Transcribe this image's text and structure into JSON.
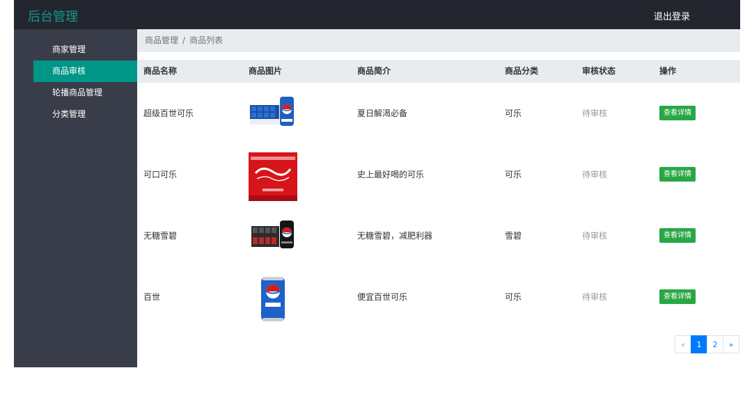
{
  "brand": "后台管理",
  "logout_label": "退出登录",
  "sidebar": {
    "items": [
      {
        "label": "商家管理",
        "active": false
      },
      {
        "label": "商品审核",
        "active": true
      },
      {
        "label": "轮播商品管理",
        "active": false
      },
      {
        "label": "分类管理",
        "active": false
      }
    ]
  },
  "breadcrumb": {
    "parent": "商品管理",
    "separator": "/",
    "current": "商品列表"
  },
  "table": {
    "headers": [
      "商品名称",
      "商品图片",
      "商品简介",
      "商品分类",
      "审核状态",
      "操作"
    ],
    "rows": [
      {
        "name": "超级百世可乐",
        "image_icon": "pepsi-case-icon",
        "intro": "夏日解渴必备",
        "category": "可乐",
        "status": "待审核",
        "action": "查看详情"
      },
      {
        "name": "可口可乐",
        "image_icon": "coca-cola-box-icon",
        "intro": "史上最好喝的可乐",
        "category": "可乐",
        "status": "待审核",
        "action": "查看详情"
      },
      {
        "name": "无糖雪碧",
        "image_icon": "black-can-case-icon",
        "intro": "无糖雪碧，减肥利器",
        "category": "雪碧",
        "status": "待审核",
        "action": "查看详情"
      },
      {
        "name": "百世",
        "image_icon": "pepsi-can-icon",
        "intro": "便宜百世可乐",
        "category": "可乐",
        "status": "待审核",
        "action": "查看详情"
      }
    ]
  },
  "pagination": {
    "prev": "«",
    "pages": [
      "1",
      "2"
    ],
    "current": "1",
    "next": "»"
  },
  "colors": {
    "topbar": "#23262e",
    "sidebar": "#393d49",
    "accent": "#009688",
    "button": "#28a745",
    "pager_active": "#007bff"
  }
}
